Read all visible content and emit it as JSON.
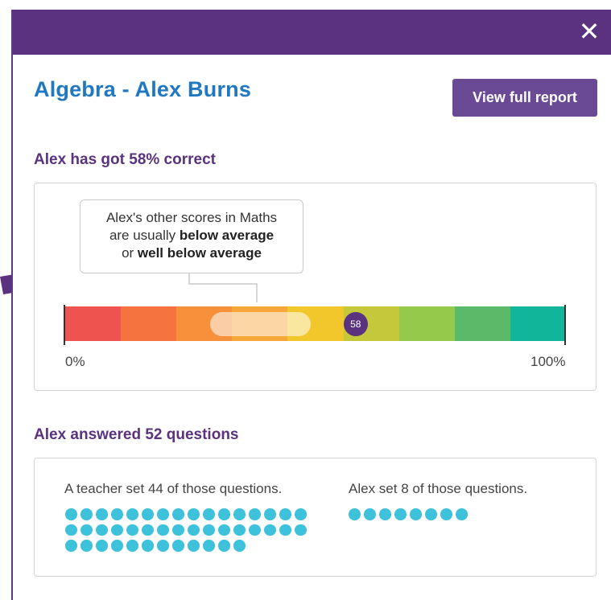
{
  "modal": {
    "close_symbol": "✕"
  },
  "header": {
    "title": "Algebra - Alex Burns",
    "report_button": "View full report"
  },
  "score": {
    "heading": "Alex has got 58% correct",
    "callout_line1": "Alex's other scores in Maths",
    "callout_line2_pre": "are usually ",
    "callout_line2_bold": "below average",
    "callout_line3_pre": "or ",
    "callout_line3_bold": "well below average",
    "marker_value": "58",
    "min_label": "0%",
    "max_label": "100%",
    "scale_colors": [
      "#ef5350",
      "#f4733f",
      "#f6903a",
      "#f7a73a",
      "#f2c72b",
      "#c5c83b",
      "#95c94b",
      "#5bb96a",
      "#11b69a"
    ],
    "usual_range_fraction": [
      0.29,
      0.49
    ],
    "score_fraction": 0.58
  },
  "questions": {
    "heading": "Alex answered 52 questions",
    "teacher_label": "A teacher set 44 of those questions.",
    "self_label": "Alex set 8 of those questions.",
    "teacher_count": 44,
    "self_count": 8,
    "dot_color": "#3ec1db"
  },
  "colors": {
    "brand_purple": "#5b327f",
    "title_blue": "#1f78c1",
    "button_purple": "#6b4a95"
  }
}
